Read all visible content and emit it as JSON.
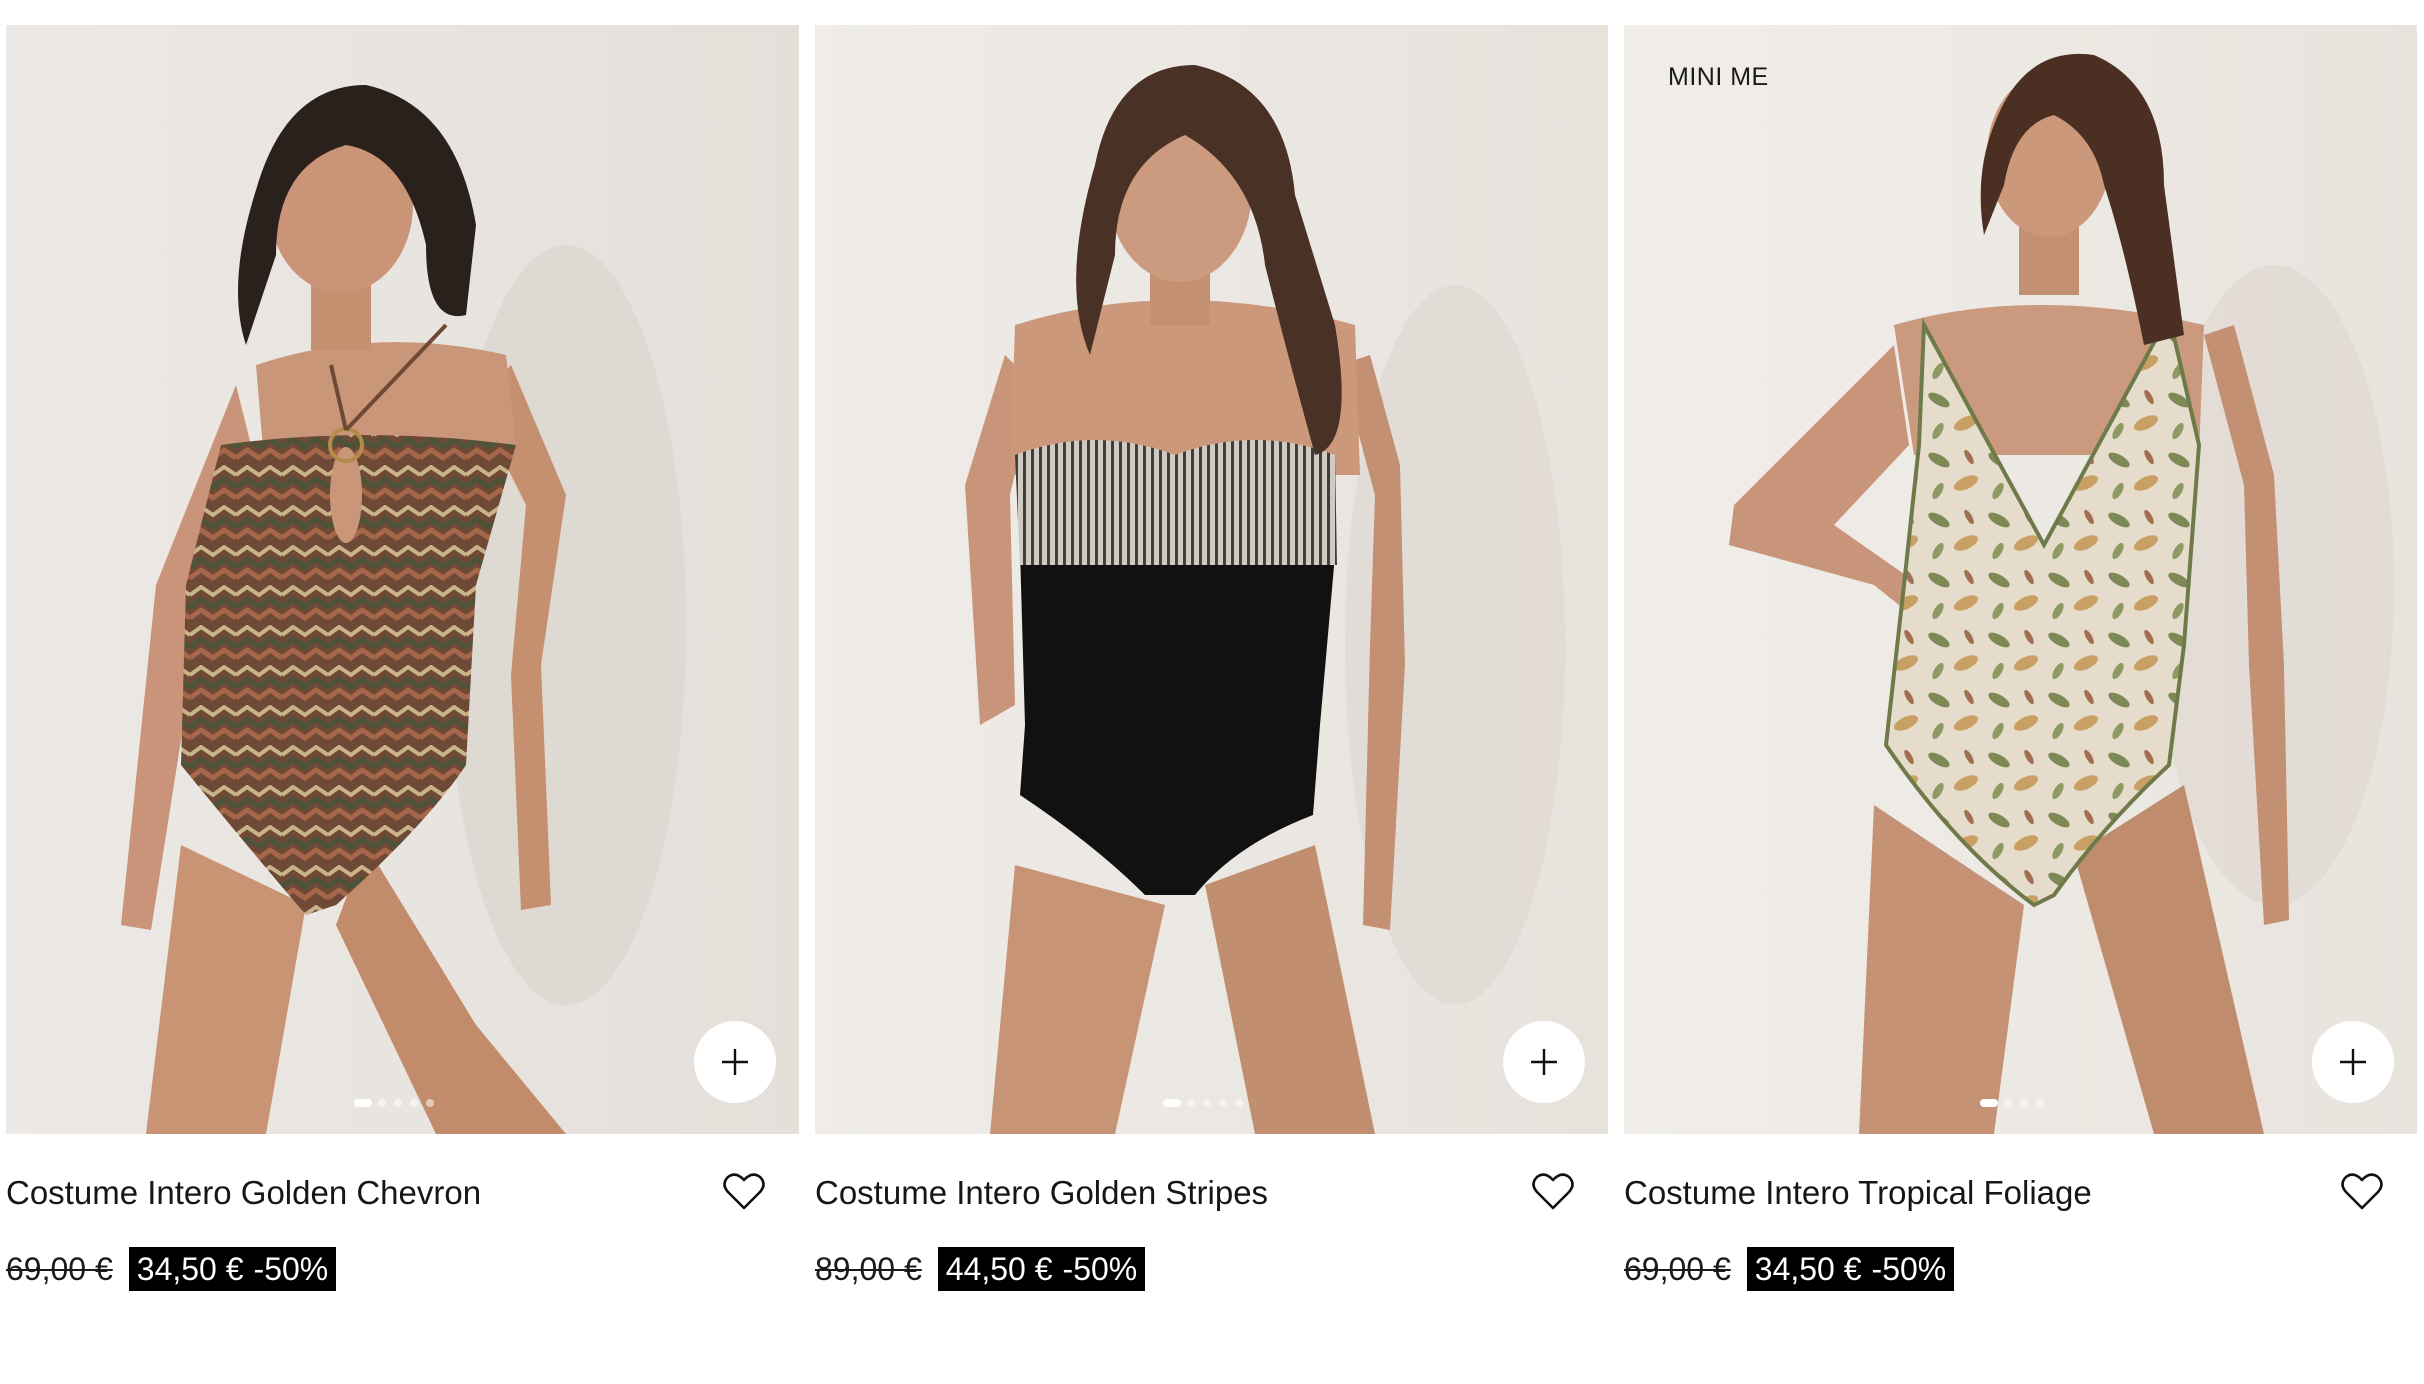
{
  "products": [
    {
      "name": "Costume Intero Golden Chevron",
      "old_price": "69,00 €",
      "sale_price": "34,50 €",
      "discount": "-50%",
      "tag": "",
      "add_icon": "plus-icon",
      "favorite_icon": "heart-icon",
      "image_count": 5,
      "active_image": 1
    },
    {
      "name": "Costume Intero Golden Stripes",
      "old_price": "89,00 €",
      "sale_price": "44,50 €",
      "discount": "-50%",
      "tag": "",
      "add_icon": "plus-icon",
      "favorite_icon": "heart-icon",
      "image_count": 5,
      "active_image": 1
    },
    {
      "name": "Costume Intero Tropical Foliage",
      "old_price": "69,00 €",
      "sale_price": "34,50 €",
      "discount": "-50%",
      "tag": "MINI ME",
      "add_icon": "plus-icon",
      "favorite_icon": "heart-icon",
      "image_count": 4,
      "active_image": 1
    }
  ],
  "colors": {
    "background": "#ffffff",
    "photo_backdrop": "#efebe6",
    "sale_badge_bg": "#000000",
    "sale_badge_text": "#ffffff",
    "text": "#161616"
  }
}
